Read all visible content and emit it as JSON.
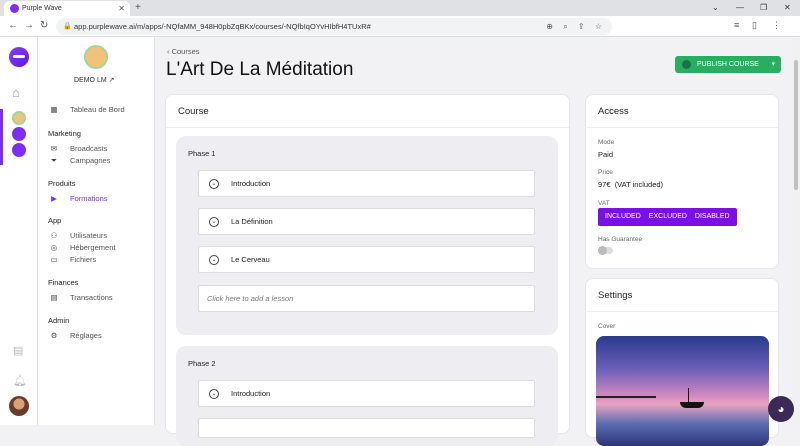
{
  "browser": {
    "tab_title": "Purple Wave",
    "url": "app.purplewave.ai/m/apps/-NQfaMM_948H0pbZqBKx/courses/-NQfbIqOYvHIbfH4TUxR#"
  },
  "profile": {
    "name": "DEMO LM"
  },
  "sidebar": {
    "dashboard": "Tableau de Bord",
    "marketing_title": "Marketing",
    "broadcasts": "Broadcasts",
    "campaigns": "Campagnes",
    "products_title": "Produits",
    "formations": "Formations",
    "app_title": "App",
    "users": "Utilisateurs",
    "hosting": "Hébergement",
    "files": "Fichiers",
    "finances_title": "Finances",
    "transactions": "Transactions",
    "admin_title": "Admin",
    "settings": "Réglages"
  },
  "header": {
    "breadcrumb": "Courses",
    "title": "L'Art De La Méditation",
    "publish_label": "PUBLISH COURSE"
  },
  "course": {
    "title": "Course",
    "phases": [
      {
        "title": "Phase 1",
        "lessons": [
          "Introduction",
          "La Définition",
          "Le Cerveau"
        ],
        "add_lesson": "Click here to add a lesson"
      },
      {
        "title": "Phase 2",
        "lessons": [
          "Introduction"
        ]
      }
    ]
  },
  "access": {
    "title": "Access",
    "mode_label": "Mode",
    "mode_value": "Paid",
    "price_label": "Price",
    "price_value": "97€",
    "price_note": "(VAT included)",
    "vat_label": "VAT",
    "vat_options": [
      "INCLUDED",
      "EXCLUDED",
      "DISABLED"
    ],
    "guarantee_label": "Has Guarantee"
  },
  "settings_card": {
    "title": "Settings",
    "cover_label": "Cover"
  },
  "colors": {
    "accent": "#7b10e6",
    "publish": "#27ae60"
  }
}
